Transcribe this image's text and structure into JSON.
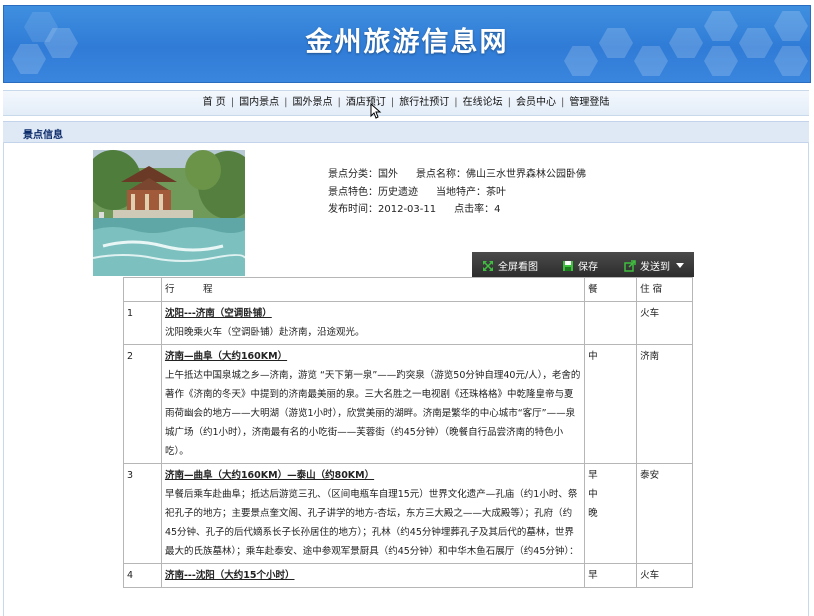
{
  "site": {
    "title": "金州旅游信息网"
  },
  "nav": {
    "items": [
      "首 页",
      "国内景点",
      "国外景点",
      "酒店预订",
      "旅行社预订",
      "在线论坛",
      "会员中心",
      "管理登陆"
    ],
    "separator": "|"
  },
  "section": {
    "title": "景点信息"
  },
  "attraction": {
    "category_label": "景点分类：",
    "category": "国外",
    "name_label": "景点名称：",
    "name": "佛山三水世界森林公园卧佛",
    "feature_label": "景点特色：",
    "feature": "历史遗迹",
    "specialty_label": "当地特产：",
    "specialty": "茶叶",
    "date_label": "发布时间：",
    "date": "2012-03-11",
    "clicks_label": "点击率：",
    "clicks": "4"
  },
  "toolbar": {
    "fullscreen": "全屏看图",
    "save": "保存",
    "send": "发送到"
  },
  "itinerary": {
    "headers": {
      "day": "",
      "route": "行　　　程",
      "meal": "餐",
      "stay": "住 宿"
    },
    "rows": [
      {
        "day": "1",
        "title": "沈阳---济南（空调卧铺）",
        "desc": "沈阳晚乘火车（空调卧铺）赴济南，沿途观光。",
        "meal": "",
        "stay": "火车"
      },
      {
        "day": "2",
        "title": "济南—曲阜（大约160KM）",
        "desc": "上午抵达中国泉城之乡—济南，游览 “天下第一泉”——趵突泉（游览50分钟自理40元/人），老舍的著作《济南的冬天》中提到的济南最美丽的泉。三大名胜之一电视剧《还珠格格》中乾隆皇帝与夏雨荷幽会的地方——大明湖（游览1小时），欣赏美丽的湖畔。济南是繁华的中心城市“客厅”——泉城广场（约1小时），济南最有名的小吃街——芙蓉街（约45分钟）（晚餐自行品尝济南的特色小吃）。",
        "meal": "中",
        "stay": "济南"
      },
      {
        "day": "3",
        "title": "济南—曲阜（大约160KM）—泰山（约80KM）",
        "desc": "早餐后乘车赴曲阜；抵达后游览三孔、（区间电瓶车自理15元）世界文化遗产—孔庙（约1小时、祭祀孔子的地方；主要景点奎文阁、孔子讲学的地方-杏坛，东方三大殿之——大成殿等）；孔府（约45分钟、孔子的后代嫡系长子长孙居住的地方）；孔林（约45分钟埋葬孔子及其后代的墓林，世界最大的氏族墓林）；乘车赴泰安、途中参观军景厨具（约45分钟）和中华木鱼石展厅（约45分钟）：",
        "meal": "早\n中\n晚",
        "stay": "泰安"
      },
      {
        "day": "4",
        "title": "济南---沈阳（大约15个小时）",
        "desc": "",
        "meal": "早",
        "stay": "火车"
      }
    ]
  }
}
